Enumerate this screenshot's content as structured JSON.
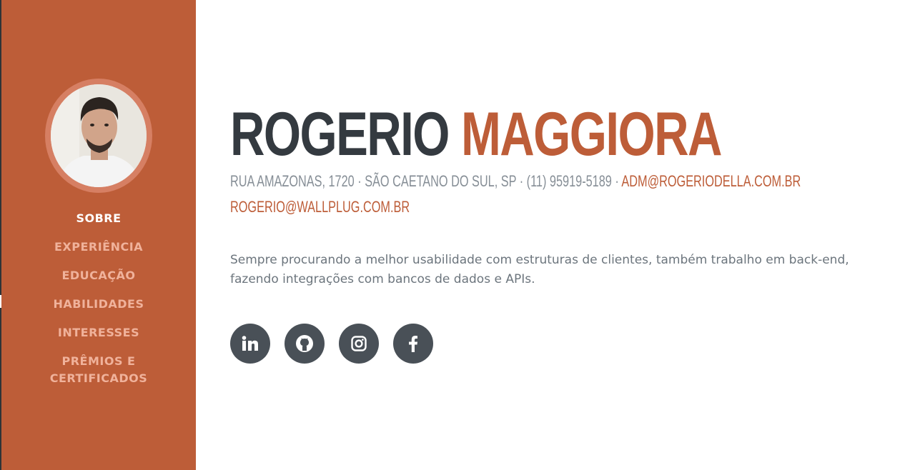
{
  "sidebar": {
    "avatar_alt": "Rogerio Maggiora",
    "nav": [
      {
        "label": "Sobre",
        "active": true
      },
      {
        "label": "Experiência",
        "active": false
      },
      {
        "label": "Educação",
        "active": false
      },
      {
        "label": "Habilidades",
        "active": false
      },
      {
        "label": "Interesses",
        "active": false
      },
      {
        "label": "Prêmios e Certificados",
        "active": false
      }
    ]
  },
  "header": {
    "first_name": "Rogerio",
    "last_name": "Maggiora"
  },
  "contact": {
    "address": "Rua Amazonas, 1720 · São Caetano do Sul, SP · (11) 95919-5189 · ",
    "email_primary": "adm@rogeriodella.com.br",
    "email_secondary": "rogerio@wallplug.com.br"
  },
  "bio": "Sempre procurando a melhor usabilidade com estruturas de clientes, também trabalho em back-end, fazendo integrações com bancos de dados e APIs.",
  "social": [
    {
      "name": "linkedin-icon"
    },
    {
      "name": "github-icon"
    },
    {
      "name": "instagram-icon"
    },
    {
      "name": "facebook-icon"
    }
  ],
  "colors": {
    "primary": "#bd5d38",
    "nav_inactive": "#f0b29b",
    "dark": "#343a40",
    "muted": "#868e96",
    "social_bg": "#495057"
  }
}
